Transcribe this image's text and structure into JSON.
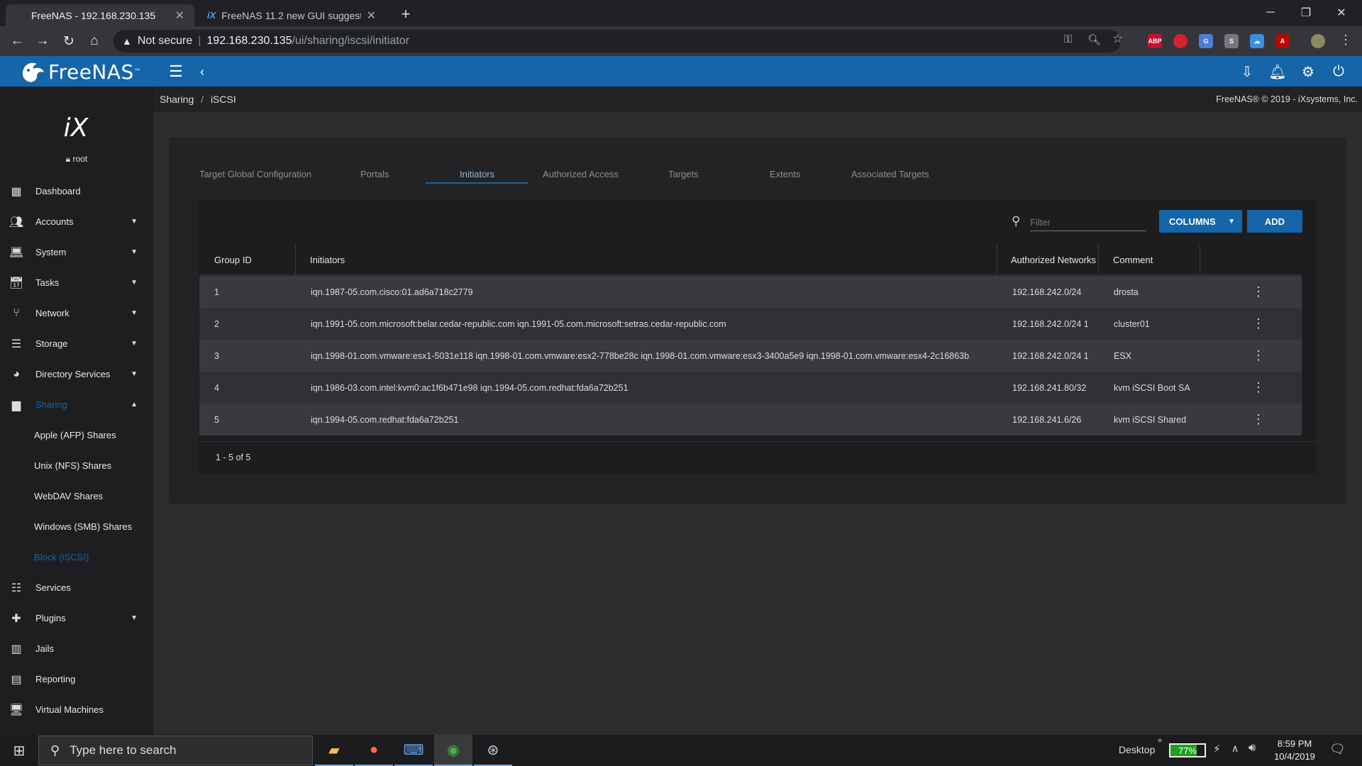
{
  "browser": {
    "tabs": [
      {
        "title": "FreeNAS - 192.168.230.135",
        "active": true
      },
      {
        "title": "FreeNAS 11.2 new GUI suggestio",
        "active": false
      }
    ],
    "new_tab": "+",
    "security": "Not secure",
    "url_host": "192.168.230.135",
    "url_path": "/ui/sharing/iscsi/initiator",
    "extensions": [
      "ABP"
    ]
  },
  "app": {
    "logo_text": "FreeNAS",
    "logo_tm": "™",
    "breadcrumb": [
      "Sharing",
      "/",
      "iSCSI"
    ],
    "copyright": "FreeNAS® © 2019 - iXsystems, Inc.",
    "brand_color": "#1565a8"
  },
  "sidebar": {
    "badge": "iX",
    "user": "root",
    "items": [
      {
        "label": "Dashboard",
        "icon": "dashboard-icon",
        "expandable": false
      },
      {
        "label": "Accounts",
        "icon": "people-icon",
        "expandable": true
      },
      {
        "label": "System",
        "icon": "laptop-icon",
        "expandable": true
      },
      {
        "label": "Tasks",
        "icon": "calendar-icon",
        "expandable": true
      },
      {
        "label": "Network",
        "icon": "network-icon",
        "expandable": true
      },
      {
        "label": "Storage",
        "icon": "storage-icon",
        "expandable": true
      },
      {
        "label": "Directory Services",
        "icon": "directory-icon",
        "expandable": true
      },
      {
        "label": "Sharing",
        "icon": "folder-shared-icon",
        "expandable": true,
        "expanded": true
      }
    ],
    "sharing_sub": [
      "Apple (AFP) Shares",
      "Unix (NFS) Shares",
      "WebDAV Shares",
      "Windows (SMB) Shares",
      "Block (iSCSI)"
    ],
    "items_after": [
      {
        "label": "Services",
        "icon": "tune-icon",
        "expandable": false
      },
      {
        "label": "Plugins",
        "icon": "extension-icon",
        "expandable": true
      },
      {
        "label": "Jails",
        "icon": "jail-icon",
        "expandable": false
      },
      {
        "label": "Reporting",
        "icon": "chart-icon",
        "expandable": false
      },
      {
        "label": "Virtual Machines",
        "icon": "computer-icon",
        "expandable": false
      }
    ]
  },
  "iscsi_tabs": [
    "Target Global Configuration",
    "Portals",
    "Initiators",
    "Authorized Access",
    "Targets",
    "Extents",
    "Associated Targets"
  ],
  "active_tab": "Initiators",
  "toolbar": {
    "filter_placeholder": "Filter",
    "columns_label": "COLUMNS",
    "add_label": "ADD"
  },
  "table": {
    "headers": [
      "Group ID",
      "Initiators",
      "Authorized Networks",
      "Comment"
    ],
    "rows": [
      {
        "id": "1",
        "initiators": "iqn.1987-05.com.cisco:01.ad6a718c2779",
        "networks": "192.168.242.0/24",
        "comment": "drosta"
      },
      {
        "id": "2",
        "initiators": "iqn.1991-05.com.microsoft:belar.cedar-republic.com iqn.1991-05.com.microsoft:setras.cedar-republic.com",
        "networks": "192.168.242.0/24 1",
        "comment": "cluster01"
      },
      {
        "id": "3",
        "initiators": "iqn.1998-01.com.vmware:esx1-5031e118 iqn.1998-01.com.vmware:esx2-778be28c iqn.1998-01.com.vmware:esx3-3400a5e9 iqn.1998-01.com.vmware:esx4-2c16863b",
        "networks": "192.168.242.0/24 1",
        "comment": "ESX"
      },
      {
        "id": "4",
        "initiators": "iqn.1986-03.com.intel:kvm0:ac1f6b471e98 iqn.1994-05.com.redhat:fda6a72b251",
        "networks": "192.168.241.80/32",
        "comment": "kvm iSCSI Boot SA"
      },
      {
        "id": "5",
        "initiators": "iqn.1994-05.com.redhat:fda6a72b251",
        "networks": "192.168.241.6/26",
        "comment": "kvm iSCSI Shared"
      }
    ],
    "pagination": "1 - 5 of 5"
  },
  "taskbar": {
    "search_placeholder": "Type here to search",
    "desktop_label": "Desktop",
    "battery": "77%",
    "time": "8:59 PM",
    "date": "10/4/2019"
  }
}
